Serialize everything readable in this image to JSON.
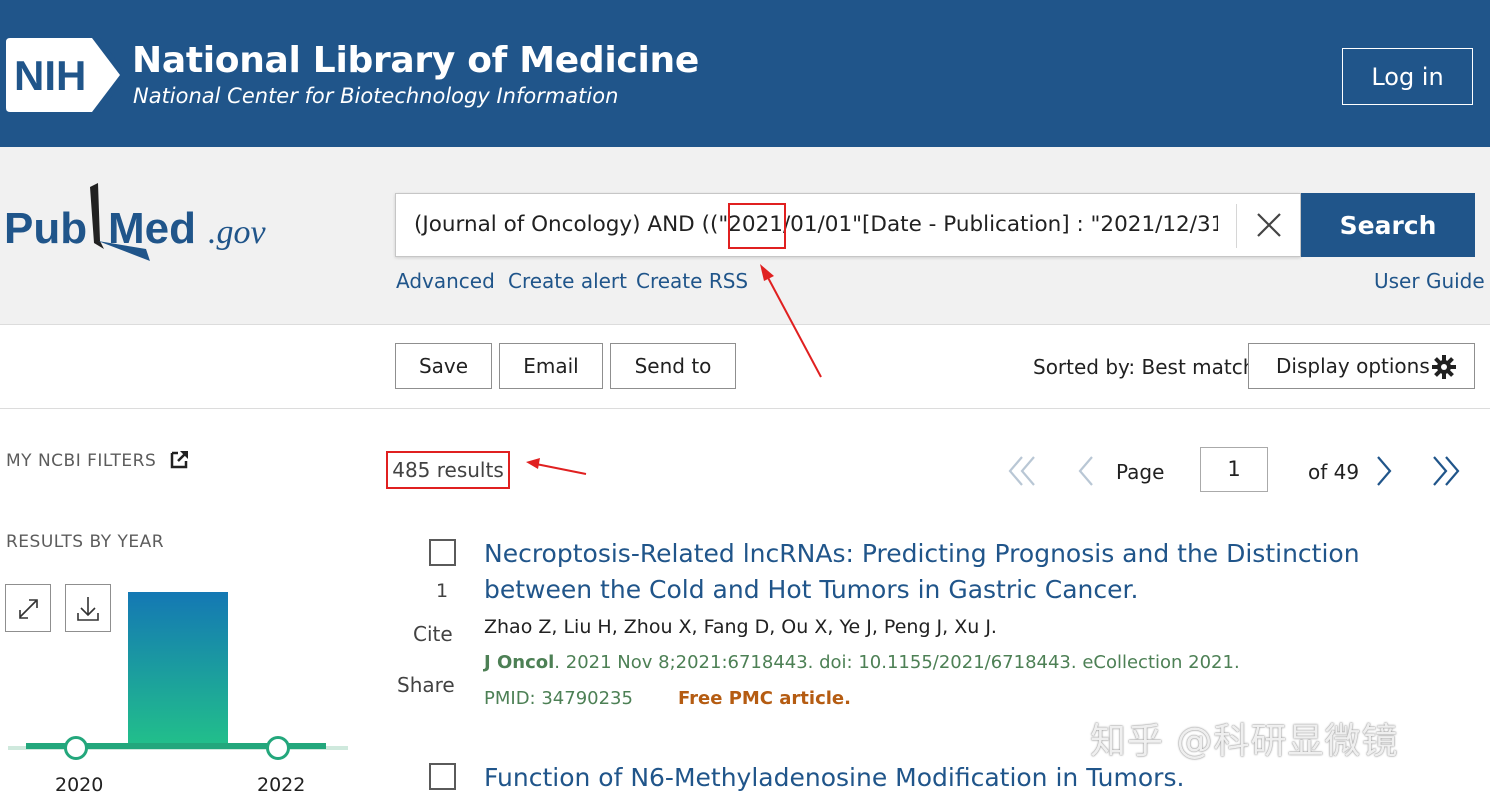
{
  "nih": {
    "logo_text": "NIH",
    "title": "National Library of Medicine",
    "subtitle": "National Center for Biotechnology Information",
    "login_label": "Log in"
  },
  "pubmed": {
    "logo_text_left": "Pub",
    "logo_text_right": "Med",
    "logo_suffix": ".gov"
  },
  "search": {
    "query": "(Journal of Oncology) AND ((\"2021/01/01\"[Date - Publication] : \"2021/12/31\"",
    "button_label": "Search",
    "links": [
      "Advanced",
      "Create alert",
      "Create RSS"
    ],
    "user_guide": "User Guide"
  },
  "actions": {
    "save": "Save",
    "email": "Email",
    "send_to": "Send to",
    "sorted_by": "Sorted by: Best match",
    "display_options": "Display options"
  },
  "sidebar": {
    "my_ncbi_filters": "MY NCBI FILTERS",
    "results_by_year": "RESULTS BY YEAR",
    "year_start": "2020",
    "year_end": "2022"
  },
  "results": {
    "count": "485 results",
    "page_label": "Page",
    "page_value": "1",
    "of_pages": "of 49",
    "items": [
      {
        "number": "1",
        "cite": "Cite",
        "share": "Share",
        "title": "Necroptosis-Related lncRNAs: Predicting Prognosis and the Distinction between the Cold and Hot Tumors in Gastric Cancer.",
        "authors": "Zhao Z, Liu H, Zhou X, Fang D, Ou X, Ye J, Peng J, Xu J.",
        "journal": "J Oncol",
        "citation": ". 2021 Nov 8;2021:6718443. doi: 10.1155/2021/6718443. eCollection 2021.",
        "pmid": "PMID: 34790235",
        "free": "Free PMC article."
      },
      {
        "title": "Function of N6-Methyladenosine Modification in Tumors."
      }
    ]
  },
  "watermark": "知乎 @科研显微镜",
  "colors": {
    "nih_blue": "#20558a",
    "annotation_red": "#e02020",
    "journal_green": "#4d8055",
    "free_orange": "#b55c12",
    "bar_top": "#1478b4",
    "bar_bottom": "#22c08a"
  }
}
